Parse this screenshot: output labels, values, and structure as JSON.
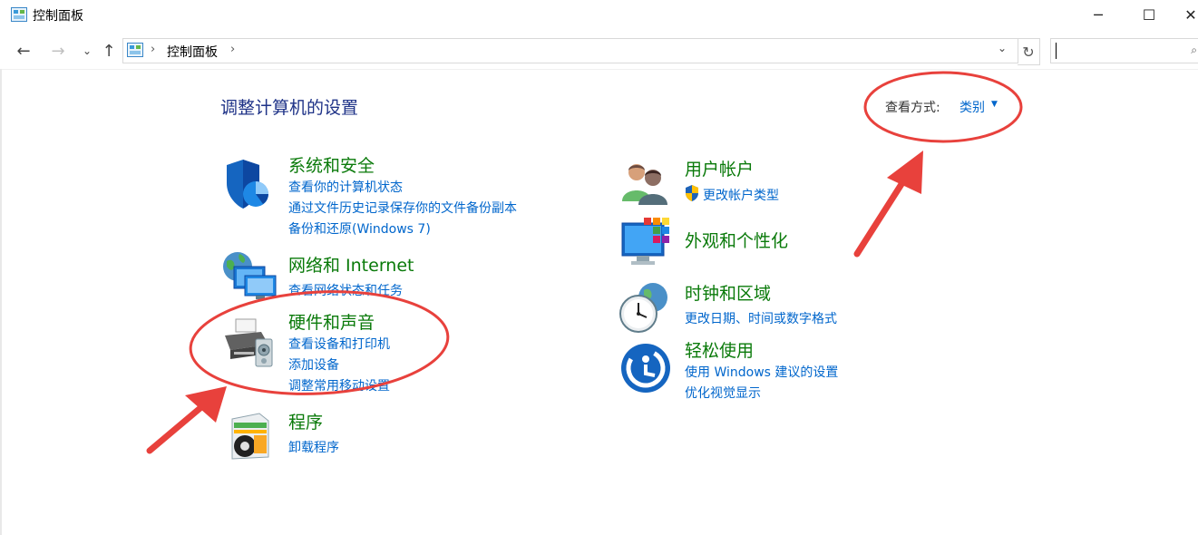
{
  "window": {
    "title": "控制面板",
    "minimize_glyph": "─",
    "maximize_glyph": "☐",
    "close_glyph": "✕"
  },
  "nav": {
    "back_glyph": "←",
    "forward_glyph": "→",
    "recent_glyph": "⌄",
    "up_glyph": "↑",
    "address_separator": "›",
    "address_path": "控制面板",
    "address_dropdown_glyph": "⌄",
    "refresh_glyph": "↻",
    "search_glyph": "⌕"
  },
  "heading": "调整计算机的设置",
  "view_by": {
    "label": "查看方式:",
    "value": "类别",
    "arrow": "▼"
  },
  "categories": [
    {
      "title": "系统和安全",
      "icon": "shield-pie-icon",
      "links": [
        "查看你的计算机状态",
        "通过文件历史记录保存你的文件备份副本",
        "备份和还原(Windows 7)"
      ]
    },
    {
      "title": "网络和 Internet",
      "icon": "network-globe-icon",
      "links": [
        "查看网络状态和任务"
      ]
    },
    {
      "title": "硬件和声音",
      "icon": "printer-speaker-icon",
      "links": [
        "查看设备和打印机",
        "添加设备",
        "调整常用移动设置"
      ]
    },
    {
      "title": "程序",
      "icon": "programs-disc-icon",
      "links": [
        "卸载程序"
      ]
    },
    {
      "title": "用户帐户",
      "icon": "users-icon",
      "links": [
        "更改帐户类型"
      ]
    },
    {
      "title": "外观和个性化",
      "icon": "monitor-palette-icon",
      "links": []
    },
    {
      "title": "时钟和区域",
      "icon": "clock-globe-icon",
      "links": [
        "更改日期、时间或数字格式"
      ]
    },
    {
      "title": "轻松使用",
      "icon": "ease-of-access-icon",
      "links": [
        "使用 Windows 建议的设置",
        "优化视觉显示"
      ]
    }
  ],
  "colors": {
    "category_title": "#0a7a0a",
    "link": "#0066cc",
    "heading": "#1e3287",
    "annotation": "#e8413c"
  }
}
